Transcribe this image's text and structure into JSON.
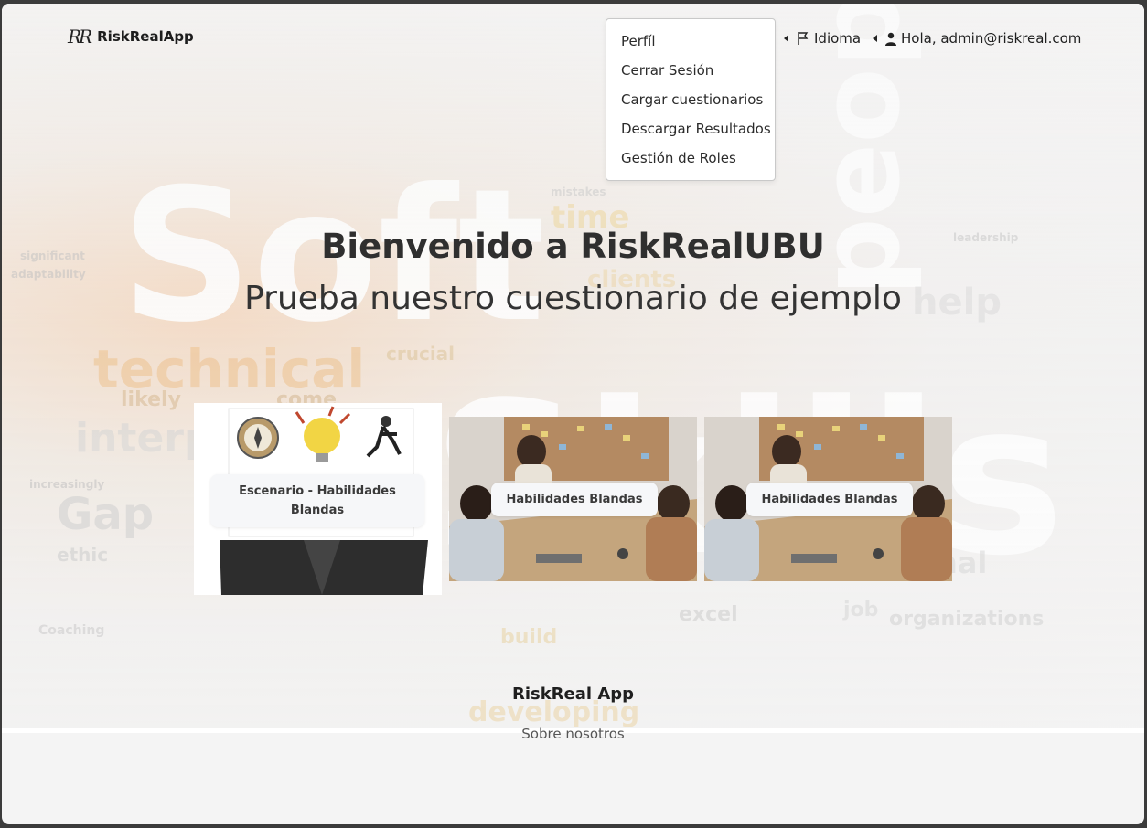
{
  "navbar": {
    "brand_logo": "RR",
    "brand_name": "RiskRealApp",
    "language_label": "Idioma",
    "user_greeting": "Hola, admin@riskreal.com",
    "icons": [
      "flag-icon",
      "user-icon",
      "caret-left-icon"
    ]
  },
  "user_menu": {
    "items": [
      {
        "label": "Perfíl"
      },
      {
        "label": "Cerrar Sesión"
      },
      {
        "label": "Cargar cuestionarios"
      },
      {
        "label": "Descargar Resultados"
      },
      {
        "label": "Gestión de Roles"
      }
    ]
  },
  "hero": {
    "title": "Bienvenido a RiskRealUBU",
    "subtitle": "Prueba nuestro cuestionario de ejemplo"
  },
  "cards": [
    {
      "label": "Escenario - Habilidades Blandas"
    },
    {
      "label": "Habilidades Blandas"
    },
    {
      "label": "Habilidades Blandas"
    }
  ],
  "footer": {
    "title": "RiskReal App",
    "link": "Sobre nosotros"
  },
  "colors": {
    "background": "#f4f4f4",
    "text_dark": "#2f2f2f",
    "card_label_bg": "#f6f7f9"
  }
}
